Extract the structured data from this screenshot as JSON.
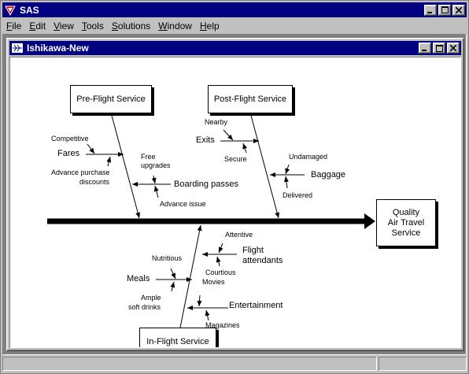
{
  "app": {
    "title": "SAS",
    "icon": "sas-icon",
    "window_controls": [
      "minimize",
      "maximize",
      "close"
    ]
  },
  "menu": [
    {
      "label": "File",
      "accel": "F",
      "rest": "ile"
    },
    {
      "label": "Edit",
      "accel": "E",
      "rest": "dit"
    },
    {
      "label": "View",
      "accel": "V",
      "rest": "iew"
    },
    {
      "label": "Tools",
      "accel": "T",
      "rest": "ools"
    },
    {
      "label": "Solutions",
      "accel": "S",
      "rest": "olutions"
    },
    {
      "label": "Window",
      "accel": "W",
      "rest": "indow"
    },
    {
      "label": "Help",
      "accel": "H",
      "rest": "elp"
    }
  ],
  "document": {
    "title": "Ishikawa-New",
    "icon": "ishikawa-diagram-icon"
  },
  "diagram": {
    "effect": {
      "line1": "Quality",
      "line2": "Air Travel",
      "line3": "Service"
    },
    "causes": {
      "pre_flight": {
        "label": "Pre-Flight Service",
        "fares": {
          "label": "Fares",
          "competitive": "Competitive",
          "advance_purchase_1": "Advance purchase",
          "advance_purchase_2": "discounts"
        },
        "boarding": {
          "label": "Boarding passes",
          "free_upgrades_1": "Free",
          "free_upgrades_2": "upgrades",
          "advance_issue": "Advance issue"
        }
      },
      "post_flight": {
        "label": "Post-Flight Service",
        "exits": {
          "label": "Exits",
          "nearby": "Nearby",
          "secure": "Secure"
        },
        "baggage": {
          "label": "Baggage",
          "undamaged": "Undamaged",
          "delivered": "Delivered"
        }
      },
      "in_flight": {
        "label": "In-Flight Service",
        "attendants": {
          "label1": "Flight",
          "label2": "attendants",
          "attentive": "Attentive",
          "courtious": "Courtious"
        },
        "meals": {
          "label": "Meals",
          "nutritious": "Nutritious",
          "ample1": "Ample",
          "ample2": "soft drinks"
        },
        "entertainment": {
          "label": "Entertainment",
          "movies": "Movies",
          "magazines": "Magazines"
        }
      }
    }
  }
}
